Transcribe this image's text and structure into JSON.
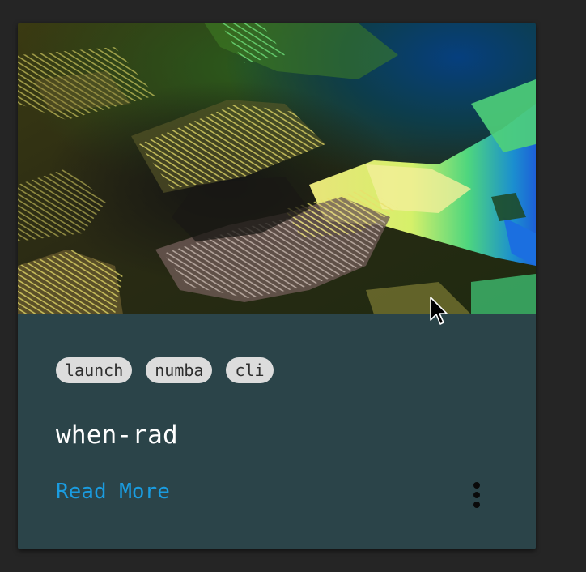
{
  "card": {
    "image_alt": "Colored terrain elevation rendering",
    "tags": [
      "launch",
      "numba",
      "cli"
    ],
    "title": "when-rad",
    "read_more_label": "Read More",
    "more_menu_icon": "more-vert-icon"
  },
  "colors": {
    "page_background": "#252525",
    "card_body": "#2b4449",
    "chip_background": "#dcdcdc",
    "chip_text": "#2e2e2e",
    "title_text": "#ffffff",
    "link": "#1a9ce0"
  }
}
